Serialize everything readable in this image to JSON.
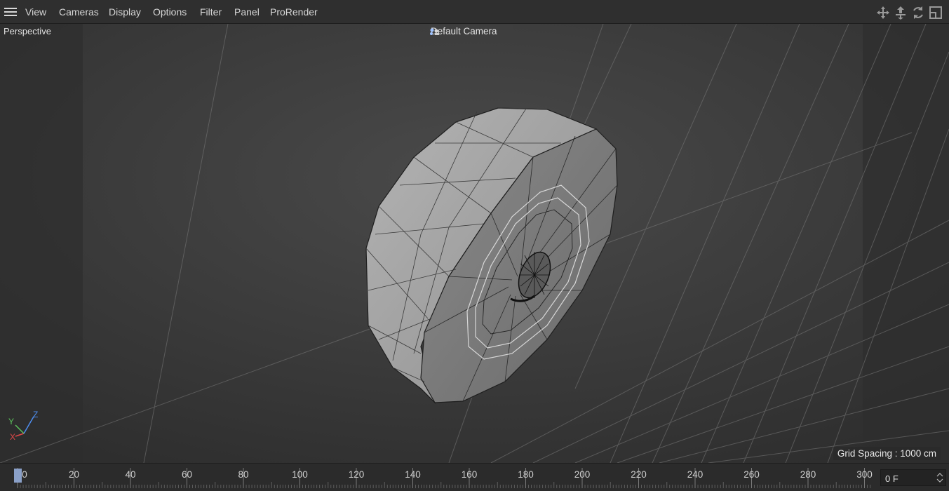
{
  "menubar": {
    "menu_icon": "hamburger-icon",
    "items": [
      "View",
      "Cameras",
      "Display",
      "Options",
      "Filter",
      "Panel",
      "ProRender"
    ],
    "nav_icons": [
      "move-view-icon",
      "dolly-view-icon",
      "rotate-view-icon",
      "maximize-view-icon"
    ]
  },
  "viewport": {
    "view_name": "Perspective",
    "camera_name": "Default Camera",
    "camera_icon": "camera-icon",
    "grid_spacing": "Grid Spacing : 1000 cm",
    "axis": {
      "x": "X",
      "y": "Y",
      "z": "Z"
    },
    "colors": {
      "x": "#e04848",
      "y": "#5cc45c",
      "z": "#4e8ef0",
      "background": "#333333"
    }
  },
  "timeline": {
    "labels": [
      "0",
      "20",
      "40",
      "60",
      "80",
      "100",
      "120",
      "140",
      "160",
      "180",
      "200",
      "220",
      "240",
      "260",
      "280",
      "300"
    ],
    "current_frame": "0 F",
    "playhead_color": "#8aa0c8"
  }
}
